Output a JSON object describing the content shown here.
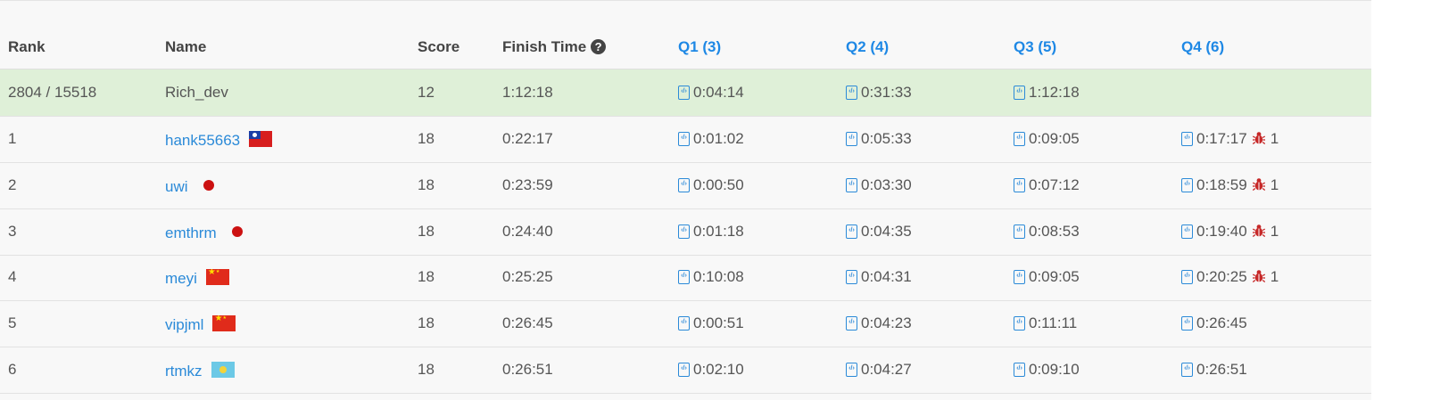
{
  "header": {
    "rank": "Rank",
    "name": "Name",
    "score": "Score",
    "finish_time": "Finish Time",
    "q1": "Q1 (3)",
    "q2": "Q2 (4)",
    "q3": "Q3 (5)",
    "q4": "Q4 (6)"
  },
  "icons": {
    "help": "question-circle-icon",
    "submission": "code-file-icon",
    "wrong_answer": "bug-icon"
  },
  "colors": {
    "link": "#2b8ad8",
    "highlight_row": "#dff0d8",
    "bug": "#c62828"
  },
  "rows": [
    {
      "rank": "2804 / 15518",
      "name": "Rich_dev",
      "score": "12",
      "finish": "1:12:18",
      "q1": "0:04:14",
      "q2": "0:31:33",
      "q3": "1:12:18",
      "q4": "",
      "q4_bugs": ""
    },
    {
      "rank": "1",
      "name": "hank55663",
      "flag": "tw",
      "score": "18",
      "finish": "0:22:17",
      "q1": "0:01:02",
      "q2": "0:05:33",
      "q3": "0:09:05",
      "q4": "0:17:17",
      "q4_bugs": "1"
    },
    {
      "rank": "2",
      "name": "uwi",
      "flag": "jp",
      "score": "18",
      "finish": "0:23:59",
      "q1": "0:00:50",
      "q2": "0:03:30",
      "q3": "0:07:12",
      "q4": "0:18:59",
      "q4_bugs": "1"
    },
    {
      "rank": "3",
      "name": "emthrm",
      "flag": "jp",
      "score": "18",
      "finish": "0:24:40",
      "q1": "0:01:18",
      "q2": "0:04:35",
      "q3": "0:08:53",
      "q4": "0:19:40",
      "q4_bugs": "1"
    },
    {
      "rank": "4",
      "name": "meyi",
      "flag": "cn",
      "score": "18",
      "finish": "0:25:25",
      "q1": "0:10:08",
      "q2": "0:04:31",
      "q3": "0:09:05",
      "q4": "0:20:25",
      "q4_bugs": "1"
    },
    {
      "rank": "5",
      "name": "vipjml",
      "flag": "cn",
      "score": "18",
      "finish": "0:26:45",
      "q1": "0:00:51",
      "q2": "0:04:23",
      "q3": "0:11:11",
      "q4": "0:26:45",
      "q4_bugs": ""
    },
    {
      "rank": "6",
      "name": "rtmkz",
      "flag": "kz",
      "score": "18",
      "finish": "0:26:51",
      "q1": "0:02:10",
      "q2": "0:04:27",
      "q3": "0:09:10",
      "q4": "0:26:51",
      "q4_bugs": ""
    }
  ]
}
